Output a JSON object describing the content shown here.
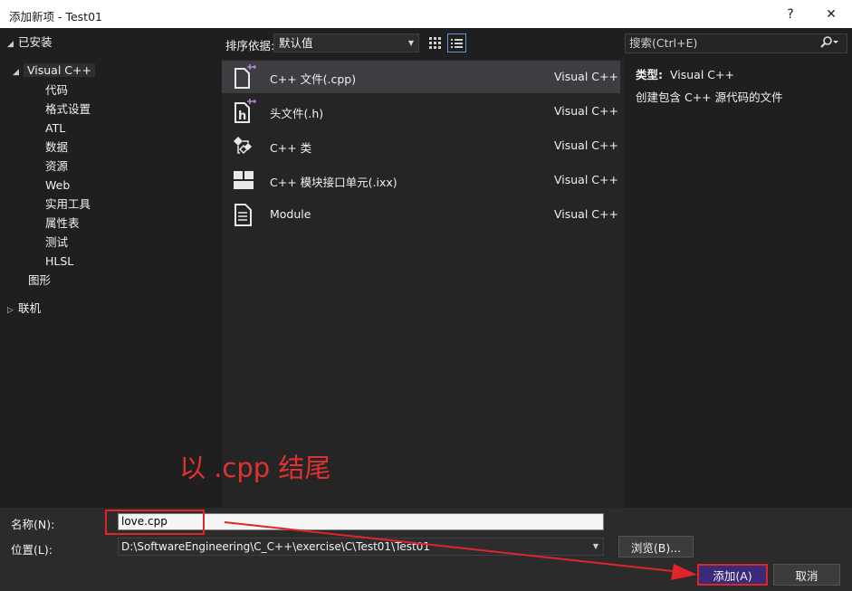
{
  "window": {
    "title": "添加新项 - Test01",
    "help_label": "?",
    "close_label": "✕"
  },
  "tree": {
    "installed": "已安装",
    "visual_cpp": "Visual C++",
    "children": [
      "代码",
      "格式设置",
      "ATL",
      "数据",
      "资源",
      "Web",
      "实用工具",
      "属性表",
      "测试",
      "HLSL"
    ],
    "graphics": "图形",
    "online": "联机"
  },
  "toolbar": {
    "sort_label": "排序依据:",
    "sort_value": "默认值"
  },
  "templates": [
    {
      "name": "C++ 文件(.cpp)",
      "type": "Visual C++",
      "icon": "cpp-file-icon"
    },
    {
      "name": "头文件(.h)",
      "type": "Visual C++",
      "icon": "header-file-icon"
    },
    {
      "name": "C++ 类",
      "type": "Visual C++",
      "icon": "class-icon"
    },
    {
      "name": "C++ 模块接口单元(.ixx)",
      "type": "Visual C++",
      "icon": "module-interface-icon"
    },
    {
      "name": "Module",
      "type": "Visual C++",
      "icon": "module-icon"
    }
  ],
  "search": {
    "placeholder": "搜索(Ctrl+E)"
  },
  "description": {
    "type_label": "类型:",
    "type_value": "Visual C++",
    "text": "创建包含 C++ 源代码的文件"
  },
  "annotation": "以 .cpp 结尾",
  "form": {
    "name_label": "名称(N):",
    "name_value": "love.cpp",
    "location_label": "位置(L):",
    "location_value": "D:\\SoftwareEngineering\\C_C++\\exercise\\C\\Test01\\Test01",
    "browse_label": "浏览(B)...",
    "add_label": "添加(A)",
    "cancel_label": "取消"
  },
  "colors": {
    "accent_purple": "#b180d7",
    "annotation_red": "#e03232",
    "add_button_bg": "#3a2a7a"
  }
}
